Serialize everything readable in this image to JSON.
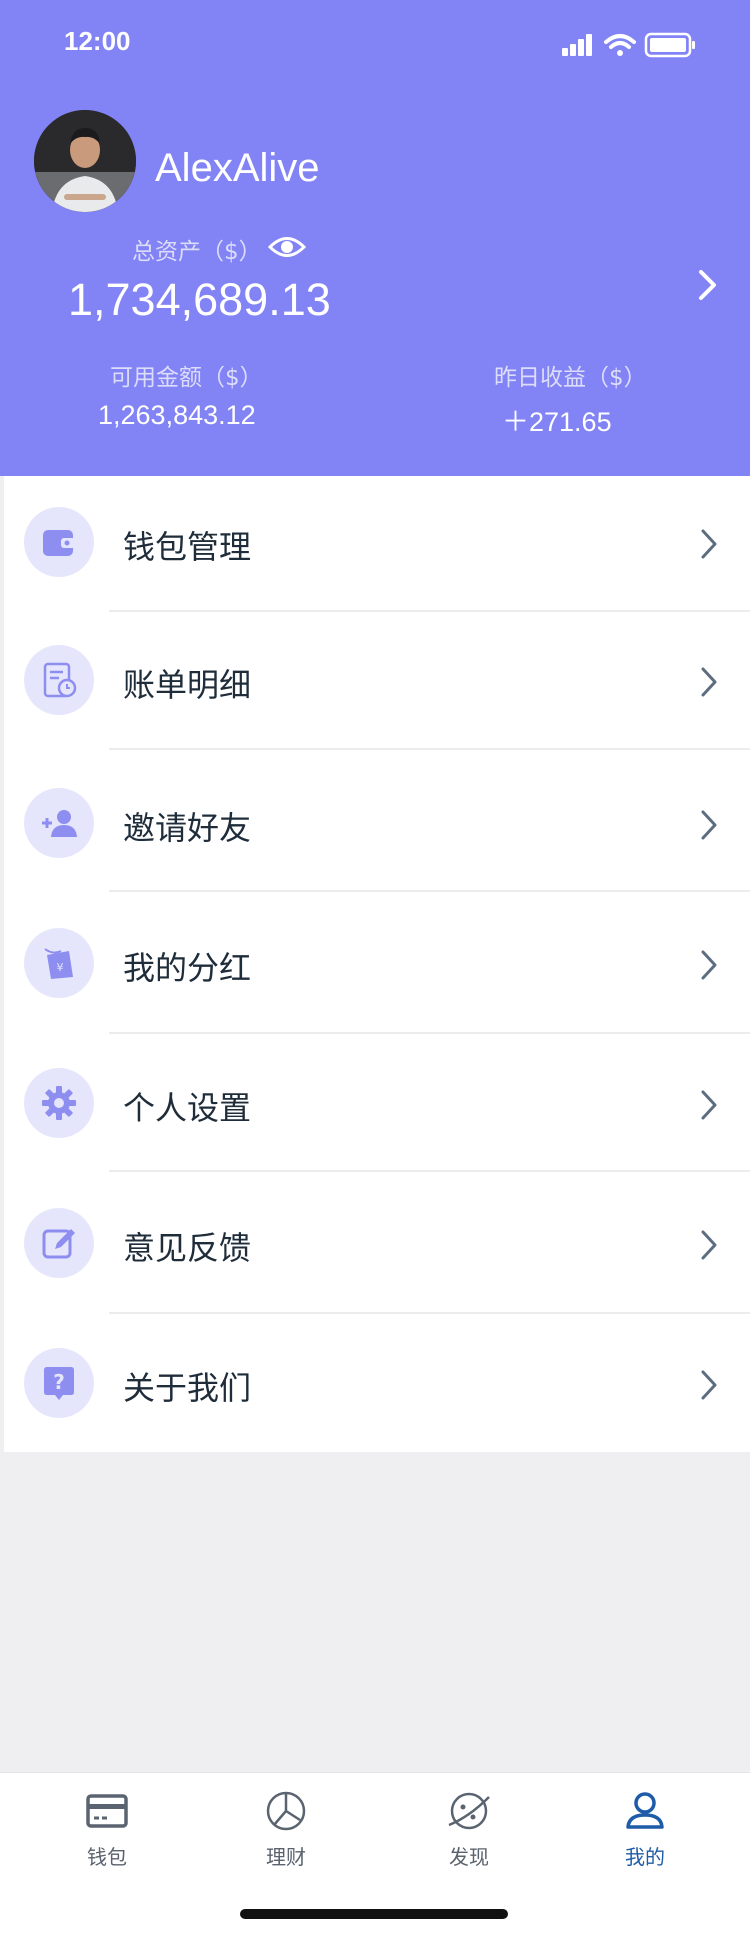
{
  "status_bar": {
    "time": "12:00"
  },
  "profile": {
    "username": "AlexAlive",
    "total_assets_label": "总资产（$）",
    "total_assets_value": "1,734,689.13",
    "available_label": "可用金额（$）",
    "available_value": "1,263,843.12",
    "yesterday_label": "昨日收益（$）",
    "yesterday_value": "＋271.65"
  },
  "menu": {
    "items": [
      {
        "label": "钱包管理",
        "icon": "wallet-icon"
      },
      {
        "label": "账单明细",
        "icon": "bill-detail-icon"
      },
      {
        "label": "邀请好友",
        "icon": "add-friend-icon"
      },
      {
        "label": "我的分红",
        "icon": "dividend-icon"
      },
      {
        "label": "个人设置",
        "icon": "gear-icon"
      },
      {
        "label": "意见反馈",
        "icon": "feedback-edit-icon"
      },
      {
        "label": "关于我们",
        "icon": "help-icon"
      }
    ]
  },
  "tabbar": {
    "tabs": [
      {
        "label": "钱包",
        "icon": "card-icon"
      },
      {
        "label": "理财",
        "icon": "pie-chart-icon"
      },
      {
        "label": "发现",
        "icon": "planet-icon"
      },
      {
        "label": "我的",
        "icon": "user-icon",
        "active": true
      }
    ]
  },
  "colors": {
    "header_bg": "#8283f5",
    "icon_circle_bg": "#e5e6fc",
    "icon_fill": "#8d8ef0",
    "active_tab": "#1f5ca8"
  }
}
